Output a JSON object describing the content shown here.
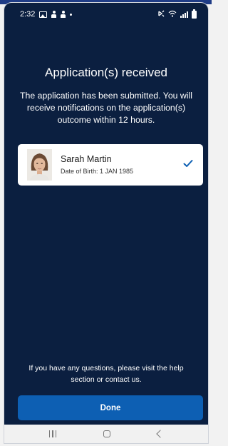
{
  "status_bar": {
    "time": "2:32"
  },
  "main": {
    "title": "Application(s) received",
    "subtitle": "The application has been submitted. You will receive notifications on the application(s) outcome within 12 hours."
  },
  "applicant_card": {
    "name": "Sarah Martin",
    "dob": "Date of Birth: 1 JAN 1985"
  },
  "footer": {
    "help_text": "If you have any questions, please visit the help section or contact us.",
    "done_label": "Done"
  },
  "colors": {
    "background": "#0b1f40",
    "card": "#ffffff",
    "button": "#0d5fb3",
    "check": "#0d5fb3"
  },
  "icons": [
    "gallery-icon",
    "person-icon",
    "mute-icon",
    "wifi-icon",
    "signal-icon",
    "battery-icon",
    "check-icon",
    "recents-icon",
    "home-icon",
    "back-icon"
  ]
}
